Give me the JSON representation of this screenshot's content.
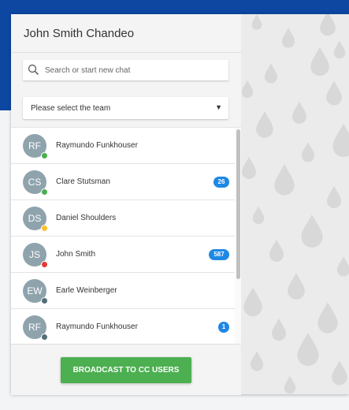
{
  "header": {
    "title": "John Smith Chandeo"
  },
  "search": {
    "placeholder": "Search or start new chat",
    "icon": "search-icon"
  },
  "team_select": {
    "selected": "Please select the team",
    "caret": "▼"
  },
  "contacts": [
    {
      "initials": "RF",
      "name": "Raymundo Funkhouser",
      "status_color": "#4caf50",
      "badge": ""
    },
    {
      "initials": "CS",
      "name": "Clare Stutsman",
      "status_color": "#4caf50",
      "badge": "26"
    },
    {
      "initials": "DS",
      "name": "Daniel Shoulders",
      "status_color": "#fbc02d",
      "badge": ""
    },
    {
      "initials": "JS",
      "name": "John Smith",
      "status_color": "#e53935",
      "badge": "587"
    },
    {
      "initials": "EW",
      "name": "Earle Weinberger",
      "status_color": "#546e7a",
      "badge": ""
    },
    {
      "initials": "RF",
      "name": "Raymundo Funkhouser",
      "status_color": "#546e7a",
      "badge": "1"
    }
  ],
  "footer": {
    "broadcast_label": "BROADCAST TO CC USERS"
  },
  "colors": {
    "brand_blue": "#0d47a1",
    "badge_blue": "#1e88e5",
    "broadcast_green": "#4caf50",
    "avatar_gray": "#8fa3ad"
  }
}
